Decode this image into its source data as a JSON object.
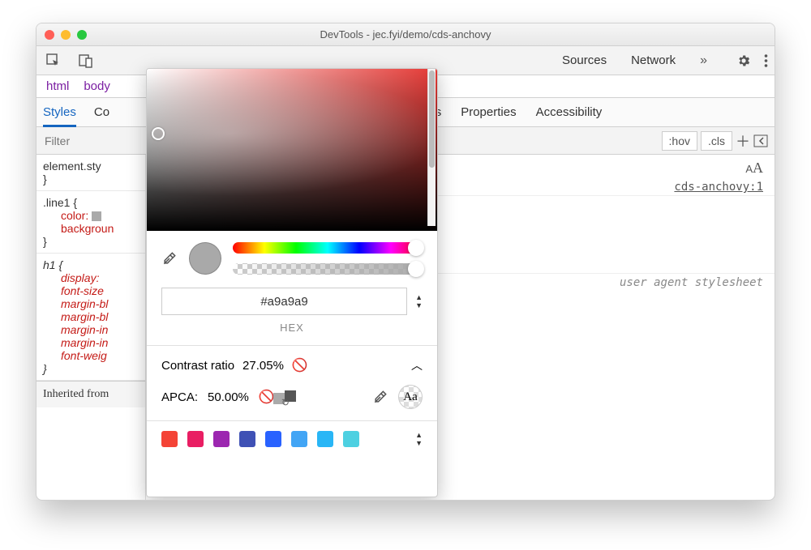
{
  "window": {
    "title": "DevTools - jec.fyi/demo/cds-anchovy"
  },
  "toolbar": {
    "tabs": [
      "Sources",
      "Network"
    ],
    "overflow": "»"
  },
  "breadcrumbs": [
    "html",
    "body"
  ],
  "subtabs": {
    "left": [
      "Styles",
      "Co"
    ],
    "mid": [
      "Breakpoints",
      "Properties",
      "Accessibility"
    ]
  },
  "filter": {
    "placeholder": "Filter",
    "hov": ":hov",
    "cls": ".cls"
  },
  "rules": {
    "r0": "element.sty",
    "r1_sel": ".line1 {",
    "r1_p1": "color:",
    "r1_p2": "backgroun",
    "r2_sel": "h1 {",
    "r2_p1": "display:",
    "r2_p2": "font-size",
    "r2_p3": "margin-bl",
    "r2_p4": "margin-bl",
    "r2_p5": "margin-in",
    "r2_p6": "margin-in",
    "r2_p7": "font-weig",
    "inherited": "Inherited from"
  },
  "right": {
    "aa": "AA",
    "source": "cds-anchovy:1",
    "uas": "user agent stylesheet"
  },
  "picker": {
    "hex": "#a9a9a9",
    "hex_label": "HEX",
    "contrast_label": "Contrast ratio",
    "contrast_value": "27.05%",
    "apca_label": "APCA:",
    "apca_value": "50.00%",
    "aa": "Aa",
    "swatches": [
      "#f44336",
      "#e91e63",
      "#9c27b0",
      "#3f51b5",
      "#2962ff",
      "#42a5f5",
      "#29b6f6",
      "#4dd0e1"
    ]
  }
}
